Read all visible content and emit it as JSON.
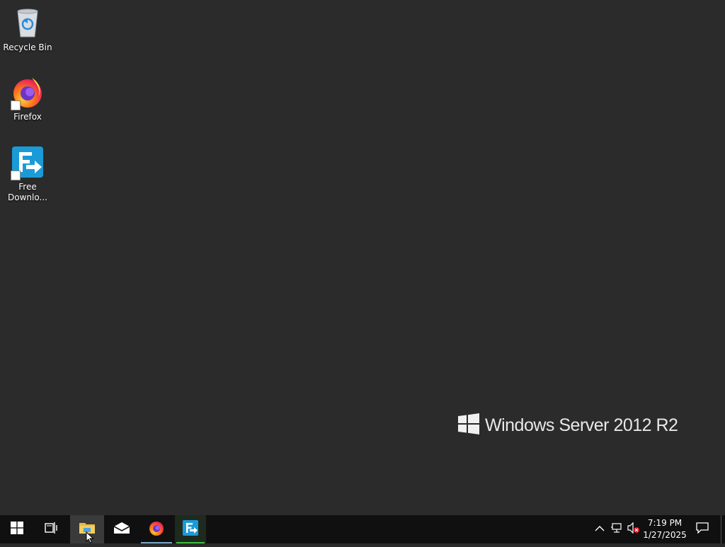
{
  "desktop": {
    "icons": [
      {
        "label": "Recycle Bin",
        "icon": "recycle-bin-icon"
      },
      {
        "label": "Firefox",
        "icon": "firefox-icon"
      },
      {
        "label_line1": "Free",
        "label_line2": "Downlo...",
        "icon": "free-download-manager-icon"
      }
    ],
    "watermark": {
      "text": "Windows Server 2012 R2"
    }
  },
  "taskbar": {
    "buttons": [
      {
        "name": "start",
        "icon": "windows-logo-icon"
      },
      {
        "name": "task-view",
        "icon": "task-view-icon"
      },
      {
        "name": "file-explorer",
        "icon": "folder-icon",
        "active": true
      },
      {
        "name": "mail",
        "icon": "mail-icon"
      },
      {
        "name": "firefox",
        "icon": "firefox-icon"
      },
      {
        "name": "free-download-manager",
        "icon": "free-download-manager-icon"
      }
    ],
    "tray": {
      "icons": [
        "chevron-up-icon",
        "network-icon",
        "volume-muted-icon"
      ],
      "time": "7:19 PM",
      "date": "1/27/2025"
    }
  },
  "colors": {
    "desktop_bg": "#2b2b2b",
    "taskbar_bg": "#101010",
    "fdm_underline": "#3fbf3f",
    "firefox_underline": "#7aa7c7"
  }
}
